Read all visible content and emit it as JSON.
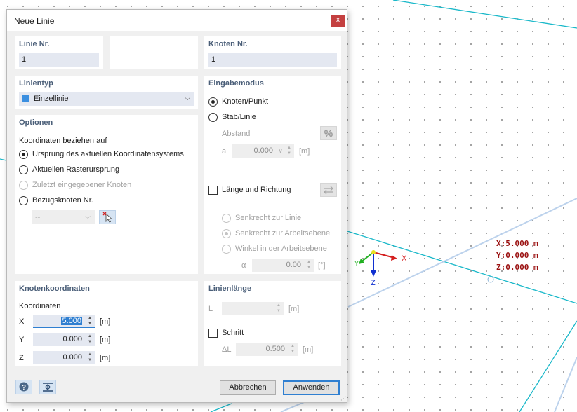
{
  "viewport": {
    "readout": {
      "x": "X:5.000 m",
      "y": "Y:0.000 m",
      "z": "Z:0.000 m"
    },
    "axes": {
      "x": "X",
      "y": "Y",
      "z": "Z"
    },
    "colors": {
      "line": "#19b8c9",
      "readout": "#9a1010",
      "x_axis": "#d42020",
      "y_axis": "#20b020",
      "z_axis": "#1030d0"
    }
  },
  "dialog": {
    "title": "Neue Linie",
    "close": "x",
    "line_no": {
      "label": "Linie Nr.",
      "value": "1"
    },
    "node_no": {
      "label": "Knoten Nr.",
      "value": "1"
    },
    "line_type": {
      "label": "Linientyp",
      "value": "Einzellinie",
      "swatch_color": "#3b8fe0"
    },
    "options": {
      "label": "Optionen",
      "sub_label": "Koordinaten beziehen auf",
      "radio_origin": "Ursprung des aktuellen Koordinatensystems",
      "radio_grid": "Aktuellen Rasterursprung",
      "radio_last": "Zuletzt eingegebener Knoten",
      "radio_ref": "Bezugsknoten Nr.",
      "ref_select": "--"
    },
    "input_mode": {
      "label": "Eingabemodus",
      "radio_node": "Knoten/Punkt",
      "radio_member": "Stab/Linie",
      "distance_label": "Abstand",
      "percent": "%",
      "a_label": "a",
      "a_value": "0.000",
      "a_unit": "[m]",
      "length_dir": "Länge und Richtung",
      "perp_line": "Senkrecht zur Linie",
      "perp_plane": "Senkrecht zur Arbeitsebene",
      "angle_plane": "Winkel in der Arbeitsebene",
      "alpha_label": "α",
      "alpha_value": "0.00",
      "alpha_unit": "[°]"
    },
    "node_coords": {
      "label": "Knotenkoordinaten",
      "sub_label": "Koordinaten",
      "x_label": "X",
      "x_value": "5.000",
      "x_unit": "[m]",
      "y_label": "Y",
      "y_value": "0.000",
      "y_unit": "[m]",
      "z_label": "Z",
      "z_value": "0.000",
      "z_unit": "[m]"
    },
    "line_length": {
      "label": "Linienlänge",
      "l_label": "L",
      "l_unit": "[m]",
      "step": "Schritt",
      "dl_label": "ΔL",
      "dl_value": "0.500",
      "dl_unit": "[m]"
    },
    "cancel": "Abbrechen",
    "apply": "Anwenden"
  }
}
